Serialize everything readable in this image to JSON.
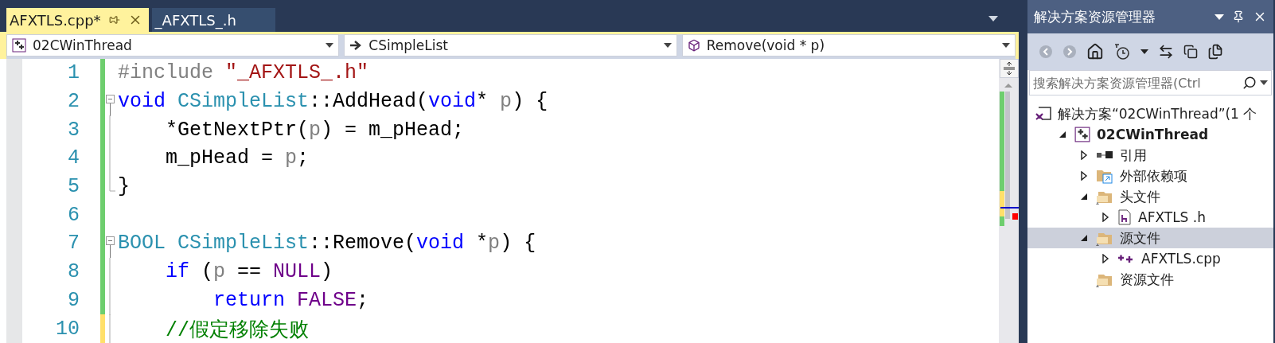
{
  "tabs": [
    {
      "label": "AFXTLS.cpp*",
      "selected": true
    },
    {
      "label": "_AFXTLS_.h",
      "selected": false
    }
  ],
  "nav_bar": [
    {
      "kind": "project",
      "value": "02CWinThread"
    },
    {
      "kind": "class",
      "value": "CSimpleList"
    },
    {
      "kind": "method",
      "value": "Remove(void * p)"
    }
  ],
  "code": [
    {
      "number": "1",
      "color": "#6ece6e",
      "kind": "plain",
      "tokens": [
        {
          "kind": "preproc",
          "t": "#include "
        },
        {
          "kind": "string",
          "t": "\"_AFXTLS_.h\""
        }
      ]
    },
    {
      "number": "2",
      "color": "#6ece6e",
      "kind": "fold-start",
      "tokens": [
        {
          "kind": "keyword",
          "t": "void "
        },
        {
          "kind": "type",
          "t": "CSimpleList"
        },
        {
          "kind": "plain",
          "t": "::AddHead("
        },
        {
          "kind": "keyword",
          "t": "void"
        },
        {
          "kind": "plain",
          "t": "* "
        },
        {
          "kind": "param",
          "t": "p"
        },
        {
          "kind": "plain",
          "t": ") {"
        }
      ]
    },
    {
      "number": "3",
      "color": "#6ece6e",
      "kind": "fold-inner",
      "tokens": [
        {
          "kind": "plain",
          "t": "    *GetNextPtr("
        },
        {
          "kind": "param",
          "t": "p"
        },
        {
          "kind": "plain",
          "t": ") = m_pHead;"
        }
      ]
    },
    {
      "number": "4",
      "color": "#6ece6e",
      "kind": "fold-inner",
      "tokens": [
        {
          "kind": "plain",
          "t": "    m_pHead = "
        },
        {
          "kind": "param",
          "t": "p"
        },
        {
          "kind": "plain",
          "t": ";"
        }
      ]
    },
    {
      "number": "5",
      "color": "#6ece6e",
      "kind": "fold-end",
      "tokens": [
        {
          "kind": "plain",
          "t": "}"
        }
      ]
    },
    {
      "number": "6",
      "color": "#6ece6e",
      "kind": "plain"
    },
    {
      "number": "7",
      "color": "#6ece6e",
      "kind": "fold-start",
      "tokens": [
        {
          "kind": "type",
          "t": "BOOL CSimpleList"
        },
        {
          "kind": "plain",
          "t": "::Remove("
        },
        {
          "kind": "keyword",
          "t": "void"
        },
        {
          "kind": "plain",
          "t": " *"
        },
        {
          "kind": "param",
          "t": "p"
        },
        {
          "kind": "plain",
          "t": ") {"
        }
      ]
    },
    {
      "number": "8",
      "color": "#6ece6e",
      "kind": "fold-inner",
      "tokens": [
        {
          "kind": "keyword",
          "t": "    if"
        },
        {
          "kind": "plain",
          "t": " ("
        },
        {
          "kind": "param",
          "t": "p"
        },
        {
          "kind": "plain",
          "t": " == "
        },
        {
          "kind": "macro",
          "t": "NULL"
        },
        {
          "kind": "plain",
          "t": ")"
        }
      ]
    },
    {
      "number": "9",
      "color": "#6ece6e",
      "kind": "fold-inner",
      "tokens": [
        {
          "kind": "keyword",
          "t": "        return"
        },
        {
          "kind": "macro",
          "t": " FALSE"
        },
        {
          "kind": "plain",
          "t": ";"
        }
      ]
    },
    {
      "number": "10",
      "color": "#ffe06a",
      "kind": "fold-inner",
      "tokens": [
        {
          "kind": "comment",
          "t": "    //假定移除失败"
        }
      ]
    }
  ],
  "explorer": {
    "title": "解决方案资源管理器",
    "search": {
      "placeholder": "搜索解决方案资源管理器(Ctrl"
    },
    "tree": [
      {
        "kind": "solution",
        "label": "解决方案“02CWinThread”(1 个",
        "selected": false,
        "children": [
          {
            "kind": "project",
            "label": "02CWinThread",
            "bold": true,
            "expanded": true,
            "selected": false,
            "children": [
              {
                "kind": "references",
                "label": "引用",
                "expanded": false,
                "selected": false
              },
              {
                "kind": "external",
                "label": "外部依赖项",
                "expanded": false,
                "selected": false
              },
              {
                "kind": "folder",
                "label": "头文件",
                "expanded": true,
                "selected": false,
                "children": [
                  {
                    "kind": "header",
                    "label": "AFXTLS .h",
                    "expanded": false,
                    "selected": false
                  }
                ]
              },
              {
                "kind": "folder",
                "label": "源文件",
                "expanded": true,
                "selected": true,
                "children": [
                  {
                    "kind": "cpp",
                    "label": "AFXTLS.cpp",
                    "expanded": false,
                    "selected": false
                  }
                ]
              },
              {
                "kind": "folder",
                "label": "资源文件",
                "selected": false
              }
            ]
          }
        ]
      }
    ]
  }
}
